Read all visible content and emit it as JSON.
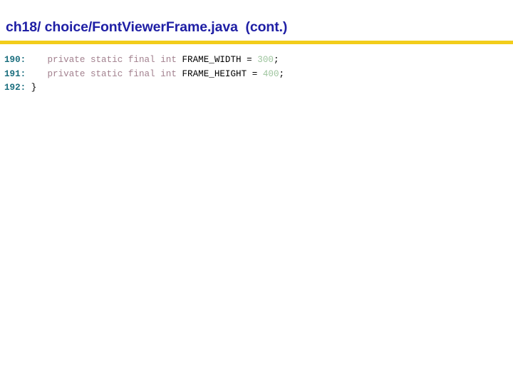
{
  "slide": {
    "title": "ch18/ choice/FontViewerFrame.java  (cont.)",
    "colors": {
      "title_text": "#1f1fa5",
      "rule": "#f2cd1b",
      "line_number": "#1a6e7e",
      "keyword": "#a2808e",
      "identifier": "#000000",
      "number_literal": "#9cc49c",
      "background": "#ffffff"
    },
    "code": {
      "lines": [
        {
          "number": "190:",
          "indent": "    ",
          "tokens": [
            {
              "text": "private",
              "kind": "keyword"
            },
            {
              "text": " ",
              "kind": "plain"
            },
            {
              "text": "static",
              "kind": "keyword"
            },
            {
              "text": " ",
              "kind": "plain"
            },
            {
              "text": "final",
              "kind": "keyword"
            },
            {
              "text": " ",
              "kind": "plain"
            },
            {
              "text": "int",
              "kind": "keyword"
            },
            {
              "text": " ",
              "kind": "plain"
            },
            {
              "text": "FRAME_WIDTH",
              "kind": "identifier"
            },
            {
              "text": " = ",
              "kind": "identifier"
            },
            {
              "text": "300",
              "kind": "number"
            },
            {
              "text": ";",
              "kind": "punc"
            }
          ]
        },
        {
          "number": "191:",
          "indent": "    ",
          "tokens": [
            {
              "text": "private",
              "kind": "keyword"
            },
            {
              "text": " ",
              "kind": "plain"
            },
            {
              "text": "static",
              "kind": "keyword"
            },
            {
              "text": " ",
              "kind": "plain"
            },
            {
              "text": "final",
              "kind": "keyword"
            },
            {
              "text": " ",
              "kind": "plain"
            },
            {
              "text": "int",
              "kind": "keyword"
            },
            {
              "text": " ",
              "kind": "plain"
            },
            {
              "text": "FRAME_HEIGHT",
              "kind": "identifier"
            },
            {
              "text": " = ",
              "kind": "identifier"
            },
            {
              "text": "400",
              "kind": "number"
            },
            {
              "text": ";",
              "kind": "punc"
            }
          ]
        },
        {
          "number": "192:",
          "indent": " ",
          "tokens": [
            {
              "text": "}",
              "kind": "punc"
            }
          ]
        }
      ]
    }
  }
}
